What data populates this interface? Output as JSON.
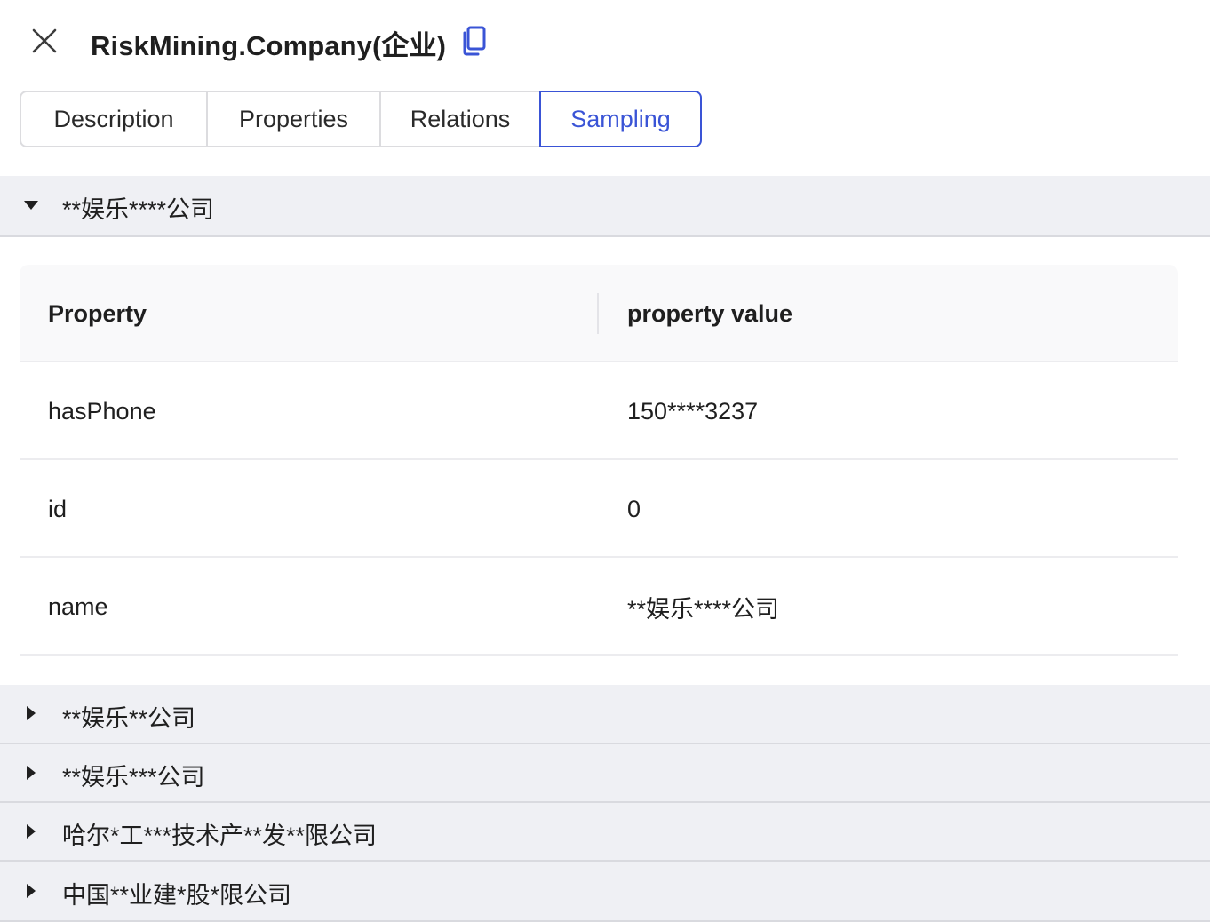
{
  "header": {
    "title": "RiskMining.Company(企业)",
    "close_icon": "close-icon",
    "copy_icon": "copy-icon"
  },
  "tabs": [
    {
      "label": "Description",
      "active": false
    },
    {
      "label": "Properties",
      "active": false
    },
    {
      "label": "Relations",
      "active": false
    },
    {
      "label": "Sampling",
      "active": true
    }
  ],
  "samples": [
    {
      "label": "**娱乐****公司",
      "expanded": true,
      "table": {
        "headers": [
          "Property",
          "property value"
        ],
        "rows": [
          {
            "property": "hasPhone",
            "value": "150****3237"
          },
          {
            "property": "id",
            "value": "0"
          },
          {
            "property": "name",
            "value": "**娱乐****公司"
          }
        ]
      }
    },
    {
      "label": "**娱乐**公司",
      "expanded": false
    },
    {
      "label": "**娱乐***公司",
      "expanded": false
    },
    {
      "label": "哈尔*工***技术产**发**限公司",
      "expanded": false
    },
    {
      "label": "中国**业建*股*限公司",
      "expanded": false
    }
  ],
  "colors": {
    "accent": "#3a54d6",
    "section_bg": "#eff0f4",
    "table_header_bg": "#f9f9fa"
  }
}
